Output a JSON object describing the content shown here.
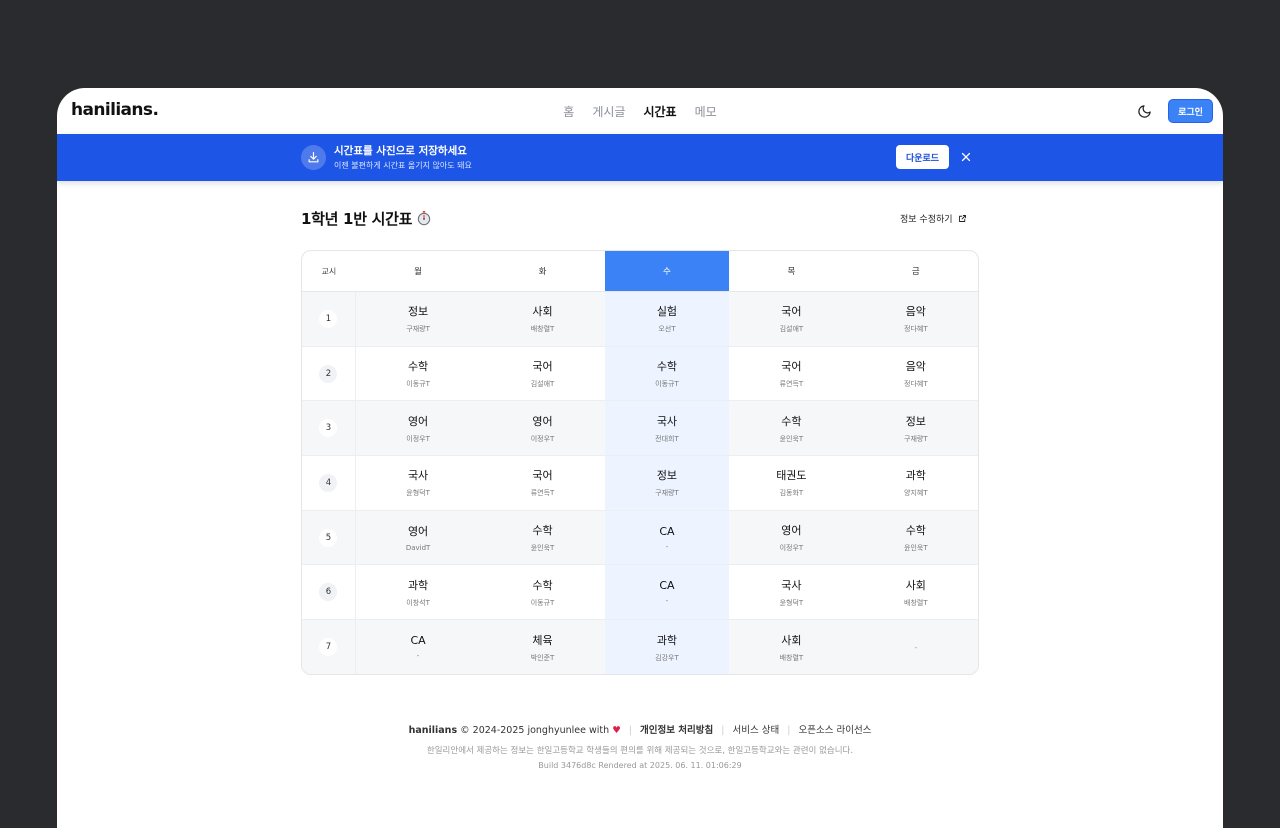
{
  "header": {
    "logo": "hanilians.",
    "nav": [
      "홈",
      "게시글",
      "시간표",
      "메모"
    ],
    "active_nav": "시간표",
    "login_label": "로그인"
  },
  "banner": {
    "title": "시간표를 사진으로 저장하세요",
    "subtitle": "이젠 불편하게 시간표 옮기지 않아도 돼요",
    "download_label": "다운로드"
  },
  "page": {
    "title": "1학년 1반 시간표",
    "edit_label": "정보 수정하기"
  },
  "timetable": {
    "period_header": "교시",
    "days": [
      "월",
      "화",
      "수",
      "목",
      "금"
    ],
    "today_index": 2,
    "rows": [
      {
        "period": "1",
        "cells": [
          {
            "subject": "정보",
            "teacher": "구재량T"
          },
          {
            "subject": "사회",
            "teacher": "배창렬T"
          },
          {
            "subject": "실험",
            "teacher": "오선T"
          },
          {
            "subject": "국어",
            "teacher": "김설애T"
          },
          {
            "subject": "음악",
            "teacher": "정다혜T"
          }
        ]
      },
      {
        "period": "2",
        "cells": [
          {
            "subject": "수학",
            "teacher": "이동규T"
          },
          {
            "subject": "국어",
            "teacher": "김설애T"
          },
          {
            "subject": "수학",
            "teacher": "이동규T"
          },
          {
            "subject": "국어",
            "teacher": "류연득T"
          },
          {
            "subject": "음악",
            "teacher": "정다혜T"
          }
        ]
      },
      {
        "period": "3",
        "cells": [
          {
            "subject": "영어",
            "teacher": "이정우T"
          },
          {
            "subject": "영어",
            "teacher": "이정우T"
          },
          {
            "subject": "국사",
            "teacher": "전대희T"
          },
          {
            "subject": "수학",
            "teacher": "윤인욱T"
          },
          {
            "subject": "정보",
            "teacher": "구재량T"
          }
        ]
      },
      {
        "period": "4",
        "cells": [
          {
            "subject": "국사",
            "teacher": "윤형덕T"
          },
          {
            "subject": "국어",
            "teacher": "류연득T"
          },
          {
            "subject": "정보",
            "teacher": "구재량T"
          },
          {
            "subject": "태권도",
            "teacher": "김동화T"
          },
          {
            "subject": "과학",
            "teacher": "양지혜T"
          }
        ]
      },
      {
        "period": "5",
        "cells": [
          {
            "subject": "영어",
            "teacher": "DavidT"
          },
          {
            "subject": "수학",
            "teacher": "윤인욱T"
          },
          {
            "subject": "CA",
            "teacher": "-"
          },
          {
            "subject": "영어",
            "teacher": "이정우T"
          },
          {
            "subject": "수학",
            "teacher": "윤인욱T"
          }
        ]
      },
      {
        "period": "6",
        "cells": [
          {
            "subject": "과학",
            "teacher": "이창석T"
          },
          {
            "subject": "수학",
            "teacher": "이동규T"
          },
          {
            "subject": "CA",
            "teacher": "-"
          },
          {
            "subject": "국사",
            "teacher": "윤형덕T"
          },
          {
            "subject": "사회",
            "teacher": "배창렬T"
          }
        ]
      },
      {
        "period": "7",
        "cells": [
          {
            "subject": "CA",
            "teacher": "-"
          },
          {
            "subject": "체육",
            "teacher": "박인준T"
          },
          {
            "subject": "과학",
            "teacher": "김강우T"
          },
          {
            "subject": "사회",
            "teacher": "배창렬T"
          },
          {
            "subject": "",
            "teacher": "-"
          }
        ]
      }
    ]
  },
  "footer": {
    "brand": "hanilians",
    "copyright": "© 2024-2025 jonghyunlee with",
    "links": [
      "개인정보 처리방침",
      "서비스 상태",
      "오픈소스 라이선스"
    ],
    "disclaimer": "한일리안에서 제공하는 정보는 한일고등학교 학생들의 편의를 위해 제공되는 것으로, 한일고등학교와는 관련이 없습니다.",
    "build": "Build 3476d8c Rendered at 2025. 06. 11. 01:06:29"
  },
  "colors": {
    "accent": "#3b82f6",
    "banner": "#1d55e6",
    "today_column": "#edf4ff",
    "page_bg": "#2a2b2f"
  },
  "icons": [
    "moon-icon",
    "download-icon",
    "close-icon",
    "stopwatch-icon",
    "external-link-icon",
    "heart-icon"
  ]
}
